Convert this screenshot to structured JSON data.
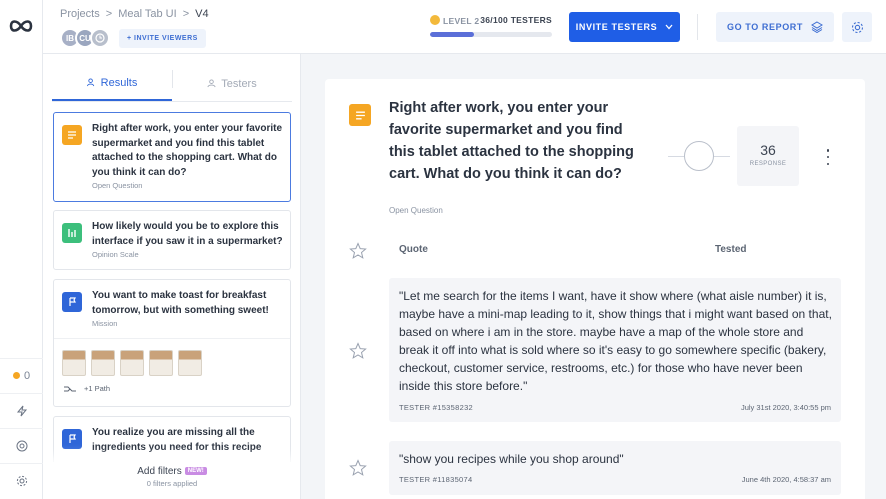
{
  "breadcrumb": {
    "projects": "Projects",
    "sep": ">",
    "project": "Meal Tab UI",
    "version": "V4"
  },
  "avatars": [
    "IB",
    "CU",
    ""
  ],
  "invite_viewers": "+ INVITE VIEWERS",
  "level": {
    "label": "LEVEL 2",
    "testers": "36/100 TESTERS",
    "progress": 0.36
  },
  "invite_testers": "INVITE TESTERS",
  "go_to_report": "GO TO REPORT",
  "rail": {
    "notifications_count": "0"
  },
  "tabs": {
    "results": "Results",
    "testers": "Testers"
  },
  "questions": [
    {
      "text": "Right after work, you enter your favorite supermarket and you find this tablet attached to the shopping cart. What do you think it can do?",
      "type": "Open Question",
      "color": "#f5a623"
    },
    {
      "text": "How likely would you be to explore this interface if you saw it in a supermarket?",
      "type": "Opinion Scale",
      "color": "#3cbf7c"
    },
    {
      "text": "You want to make toast for breakfast tomorrow,  but with something sweet!",
      "type": "Mission",
      "color": "#2f66d8"
    },
    {
      "text": "You realize you are missing all the ingredients you need for this recipe",
      "type": "",
      "color": "#2f66d8"
    }
  ],
  "mission_path": "+1 Path",
  "filters": {
    "title": "Add filters",
    "badge": "NEW!",
    "applied": "0 filters applied"
  },
  "main": {
    "title": "Right after work, you enter your favorite supermarket and you find this tablet attached to the shopping cart. What do you think it can do?",
    "type": "Open Question",
    "responses": "36",
    "responses_label": "RESPONSE",
    "col_quote": "Quote",
    "col_tested": "Tested",
    "quotes": [
      {
        "text": "\"Let me search for the items I want, have it show where (what aisle number) it is, maybe have a mini-map leading to it, show things that i might want based on that, based on where i am in the store. maybe have a map of the whole store and break it off into what is sold where so it's easy to go somewhere specific (bakery, checkout, customer service, restrooms, etc.) for those who have never been inside this store before.\"",
        "tester": "TESTER #15358232",
        "date": "July 31st 2020, 3:40:55 pm"
      },
      {
        "text": "\"show you recipes while you shop around\"",
        "tester": "TESTER #11835074",
        "date": "June 4th 2020, 4:58:37 am"
      }
    ]
  }
}
